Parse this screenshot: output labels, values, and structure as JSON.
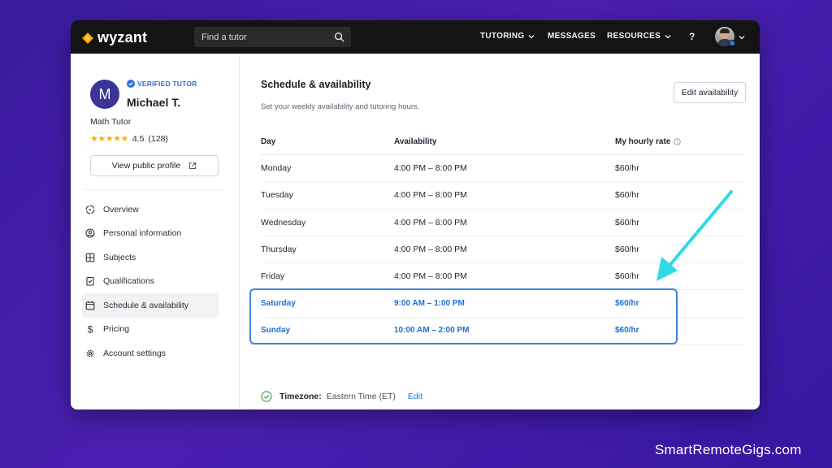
{
  "header": {
    "logo_text": "wyzant",
    "search_placeholder": "Find a tutor",
    "nav": [
      {
        "label": "TUTORING",
        "has_dropdown": true
      },
      {
        "label": "MESSAGES",
        "has_dropdown": false
      },
      {
        "label": "RESOURCES",
        "has_dropdown": true
      }
    ],
    "help_label": "?"
  },
  "profile": {
    "initial": "M",
    "verified_label": "VERIFIED TUTOR",
    "name": "Michael T.",
    "role": "Math Tutor",
    "stars": "★★★★★",
    "rating": "4.5",
    "review_count": "(128)",
    "view_profile_label": "View public profile"
  },
  "sidebar": {
    "items": [
      {
        "label": "Overview",
        "icon": "overview-icon",
        "active": false
      },
      {
        "label": "Personal information",
        "icon": "user-icon",
        "active": false
      },
      {
        "label": "Subjects",
        "icon": "subjects-icon",
        "active": false
      },
      {
        "label": "Qualifications",
        "icon": "qualifications-icon",
        "active": false
      },
      {
        "label": "Schedule & availability",
        "icon": "calendar-icon",
        "active": true
      },
      {
        "label": "Pricing",
        "icon": "dollar-icon",
        "active": false
      },
      {
        "label": "Account settings",
        "icon": "gear-icon",
        "active": false
      }
    ]
  },
  "main": {
    "title": "Schedule & availability",
    "subtitle": "Set your weekly availability and tutoring hours.",
    "edit_label": "Edit availability",
    "table": {
      "headers": {
        "day": "Day",
        "availability": "Availability",
        "rate": "My hourly rate"
      },
      "rows": [
        {
          "day": "Monday",
          "availability": "4:00 PM – 8:00 PM",
          "rate": "$60/hr",
          "highlighted": false
        },
        {
          "day": "Tuesday",
          "availability": "4:00 PM – 8:00 PM",
          "rate": "$60/hr",
          "highlighted": false
        },
        {
          "day": "Wednesday",
          "availability": "4:00 PM – 8:00 PM",
          "rate": "$60/hr",
          "highlighted": false
        },
        {
          "day": "Thursday",
          "availability": "4:00 PM – 8:00 PM",
          "rate": "$60/hr",
          "highlighted": false
        },
        {
          "day": "Friday",
          "availability": "4:00 PM – 8:00 PM",
          "rate": "$60/hr",
          "highlighted": false
        },
        {
          "day": "Saturday",
          "availability": "9:00 AM – 1:00 PM",
          "rate": "$60/hr",
          "highlighted": true
        },
        {
          "day": "Sunday",
          "availability": "10:00 AM – 2:00 PM",
          "rate": "$60/hr",
          "highlighted": true
        }
      ]
    },
    "timezone": {
      "label": "Timezone:",
      "value": "Eastern Time (ET)",
      "edit_label": "Edit"
    }
  },
  "watermark": "SmartRemoteGigs.com",
  "colors": {
    "background": "#4b1fb0",
    "topbar": "#141414",
    "accent_blue": "#1f6fd6",
    "arrow": "#2fd9e8",
    "avatar": "#3b3598",
    "stars": "#f5b400"
  }
}
